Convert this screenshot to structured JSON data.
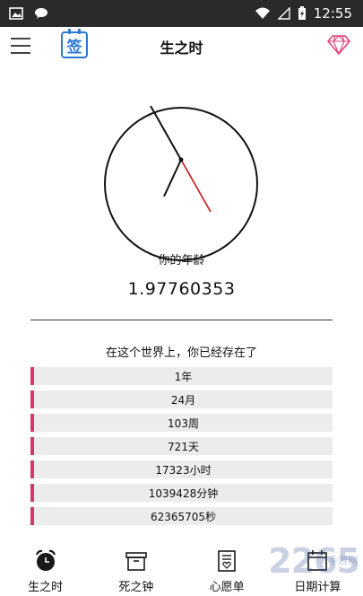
{
  "status_bar": {
    "time": "12:55"
  },
  "header": {
    "title": "生之时",
    "sign_label": "签"
  },
  "age": {
    "label": "你的年龄",
    "value": "1.97760353"
  },
  "existence": {
    "title": "在这个世界上，你已经存在了",
    "rows": [
      "1年",
      "24月",
      "103周",
      "721天",
      "17323小时",
      "1039428分钟",
      "62365705秒"
    ]
  },
  "tabs": [
    {
      "label": "生之时",
      "icon": "alarm-clock-icon"
    },
    {
      "label": "死之钟",
      "icon": "box-icon"
    },
    {
      "label": "心愿单",
      "icon": "wish-list-icon"
    },
    {
      "label": "日期计算",
      "icon": "calendar-icon"
    }
  ],
  "watermark": {
    "brand": "2265",
    "sub": "手游网"
  },
  "colors": {
    "accent_blue": "#2b78d6",
    "row_marker": "#d4376e",
    "second_hand": "#cc1111",
    "vip": "#e0407a"
  }
}
